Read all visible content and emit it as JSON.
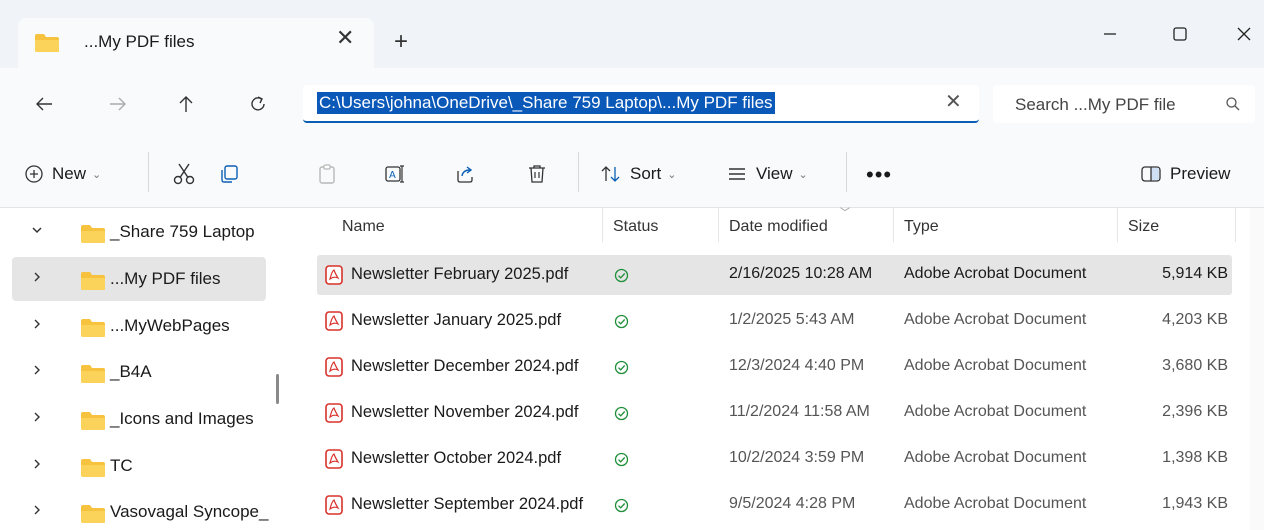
{
  "window": {
    "tab_title": "...My PDF files"
  },
  "navigation": {
    "address": "C:\\Users\\johna\\OneDrive\\_Share 759 Laptop\\...My PDF files",
    "search_placeholder": "Search ...My PDF file"
  },
  "toolbar": {
    "new_label": "New",
    "sort_label": "Sort",
    "view_label": "View",
    "more_label": "•••",
    "preview_label": "Preview"
  },
  "sidebar": {
    "items": [
      {
        "label": "_Share 759 Laptop",
        "expanded": true,
        "selected": false
      },
      {
        "label": "...My PDF files",
        "expanded": false,
        "selected": true
      },
      {
        "label": "...MyWebPages",
        "expanded": false,
        "selected": false
      },
      {
        "label": "_B4A",
        "expanded": false,
        "selected": false
      },
      {
        "label": "_Icons and Images",
        "expanded": false,
        "selected": false
      },
      {
        "label": "TC",
        "expanded": false,
        "selected": false
      },
      {
        "label": "Vasovagal Syncope_",
        "expanded": false,
        "selected": false
      }
    ]
  },
  "file_list": {
    "columns": {
      "name": "Name",
      "status": "Status",
      "date": "Date modified",
      "type": "Type",
      "size": "Size"
    },
    "rows": [
      {
        "name": "Newsletter February 2025.pdf",
        "date": "2/16/2025 10:28 AM",
        "type": "Adobe Acrobat Document",
        "size": "5,914 KB",
        "selected": true
      },
      {
        "name": "Newsletter January 2025.pdf",
        "date": "1/2/2025 5:43 AM",
        "type": "Adobe Acrobat Document",
        "size": "4,203 KB",
        "selected": false
      },
      {
        "name": "Newsletter December 2024.pdf",
        "date": "12/3/2024 4:40 PM",
        "type": "Adobe Acrobat Document",
        "size": "3,680 KB",
        "selected": false
      },
      {
        "name": "Newsletter November 2024.pdf",
        "date": "11/2/2024 11:58 AM",
        "type": "Adobe Acrobat Document",
        "size": "2,396 KB",
        "selected": false
      },
      {
        "name": "Newsletter October 2024.pdf",
        "date": "10/2/2024 3:59 PM",
        "type": "Adobe Acrobat Document",
        "size": "1,398 KB",
        "selected": false
      },
      {
        "name": "Newsletter September 2024.pdf",
        "date": "9/5/2024 4:28 PM",
        "type": "Adobe Acrobat Document",
        "size": "1,943 KB",
        "selected": false
      }
    ]
  },
  "colors": {
    "folder": "#f7c23e",
    "accent": "#0a58b8",
    "pdf_red": "#d8322b",
    "sync_green": "#1f8f3a"
  }
}
